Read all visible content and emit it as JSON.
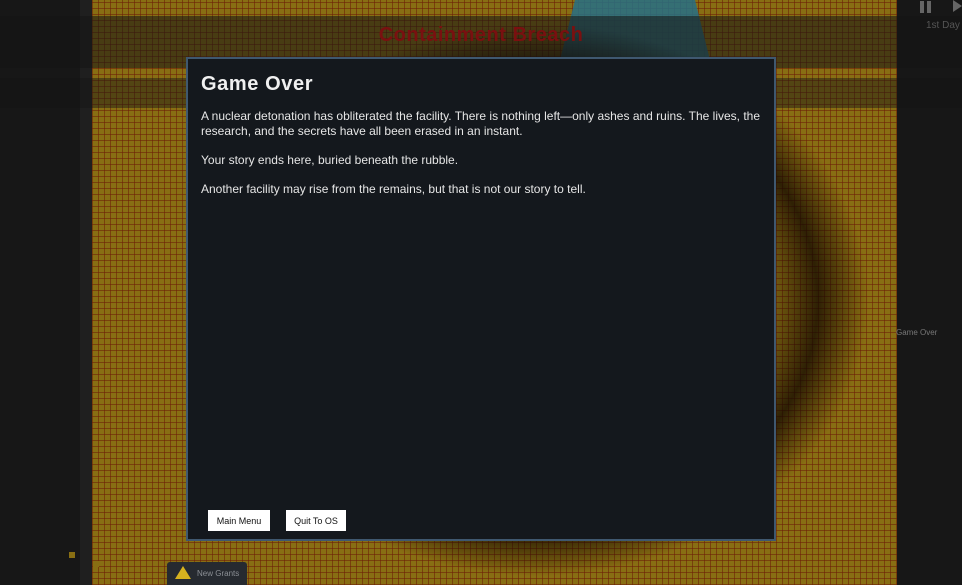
{
  "hud": {
    "event_title": "Containment Breach",
    "day_label": "1st Day",
    "side_status": "Game Over",
    "notification_label": "New Grants"
  },
  "dialog": {
    "title": "Game Over",
    "paragraphs": [
      "A nuclear detonation has obliterated the facility. There is nothing left—only ashes and ruins. The lives, the research, and the secrets have all been erased in an instant.",
      "Your story ends here, buried beneath the rubble.",
      "Another facility may rise from the remains, but that is not our story to tell."
    ],
    "buttons": {
      "main_menu": "Main Menu",
      "quit": "Quit To OS"
    }
  },
  "icons": {
    "pause": "pause-icon",
    "play": "play-icon",
    "warning": "warning-icon"
  },
  "colors": {
    "dialog_bg": "#14181d",
    "dialog_border": "#3f5870",
    "event_title": "#7a1010",
    "map_floor": "#c9a21c"
  }
}
